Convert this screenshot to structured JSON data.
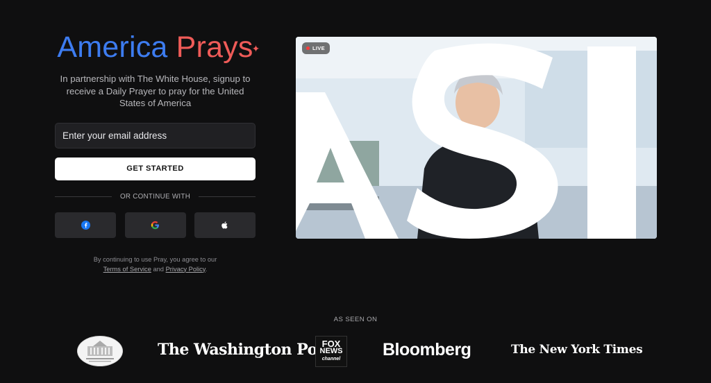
{
  "brand": {
    "word1": "America",
    "word2": "Prays"
  },
  "tagline": "In partnership with The White House, signup to receive a Daily Prayer to pray for the United States of America",
  "signup": {
    "email_placeholder": "Enter your email address",
    "cta_label": "GET STARTED",
    "divider_label": "OR CONTINUE WITH",
    "social": [
      {
        "name": "facebook",
        "icon": "facebook-icon"
      },
      {
        "name": "google",
        "icon": "google-icon"
      },
      {
        "name": "apple",
        "icon": "apple-icon"
      }
    ]
  },
  "legal": {
    "line1": "By continuing to use Pray, you agree to our",
    "terms": "Terms of Service",
    "and": "and",
    "privacy": "Privacy Policy",
    "end": "."
  },
  "video": {
    "live_label": "LIVE",
    "overlay_text": "ASI"
  },
  "press": {
    "heading": "AS SEEN ON",
    "outlets": [
      "THE WHITE HOUSE",
      "The Washington Post",
      "FOX NEWS channel",
      "Bloomberg",
      "The New York Times"
    ],
    "wapo_label": "The Washington Post",
    "fox_lines": [
      "FOX",
      "NEWS",
      "channel"
    ],
    "bloomberg_label": "Bloomberg",
    "nyt_label": "The New York Times"
  },
  "colors": {
    "brand_blue": "#3d7cf0",
    "brand_red": "#ef5b58",
    "background": "#0f0f10",
    "live_dot": "#ff3b3b"
  }
}
